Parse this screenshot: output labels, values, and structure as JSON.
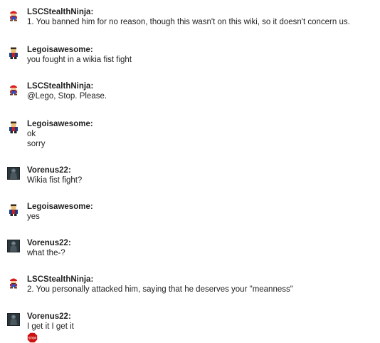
{
  "messages": [
    {
      "user": "LSCStealthNinja:",
      "avatar": "mario-avatar-icon",
      "lines": [
        "1. You banned him for no reason, though this wasn't on this wiki, so it doesn't concern us."
      ]
    },
    {
      "user": "Legoisawesome:",
      "avatar": "lego-character-avatar-icon",
      "lines": [
        "you fought in a wikia fist fight"
      ]
    },
    {
      "user": "LSCStealthNinja:",
      "avatar": "mario-avatar-icon",
      "lines": [
        "@Lego, Stop. Please."
      ]
    },
    {
      "user": "Legoisawesome:",
      "avatar": "lego-character-avatar-icon",
      "lines": [
        "ok",
        "sorry"
      ]
    },
    {
      "user": "Vorenus22:",
      "avatar": "dark-warrior-avatar-icon",
      "lines": [
        "Wikia fist fight?"
      ]
    },
    {
      "user": "Legoisawesome:",
      "avatar": "lego-character-avatar-icon",
      "lines": [
        "yes"
      ]
    },
    {
      "user": "Vorenus22:",
      "avatar": "dark-warrior-avatar-icon",
      "lines": [
        "what the-?"
      ]
    },
    {
      "user": "LSCStealthNinja:",
      "avatar": "mario-avatar-icon",
      "lines": [
        "2. You personally attacked him, saying that he deserves your \"meanness\""
      ]
    },
    {
      "user": "Vorenus22:",
      "avatar": "dark-warrior-avatar-icon",
      "lines": [
        "I get it I get it"
      ],
      "emote": "stop-sign-emote-icon"
    }
  ],
  "emote_text": "STOP",
  "colors": {
    "text": "#222222",
    "stop_sign": "#cc1111"
  }
}
